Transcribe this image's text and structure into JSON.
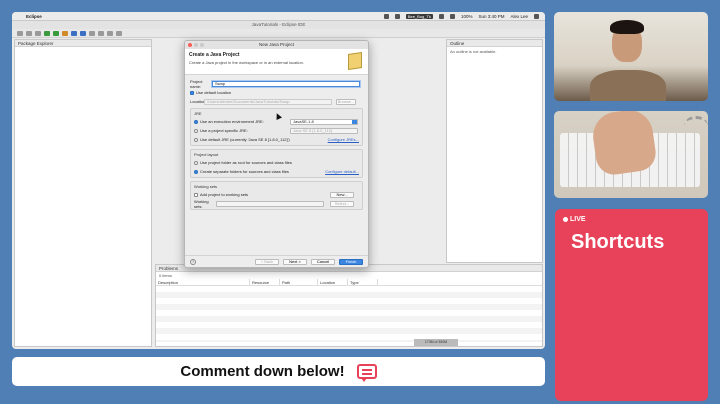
{
  "menubar": {
    "app_name": "Eclipse",
    "status_badge": "Bee_Bug_Tk",
    "battery": "100%",
    "clock": "Sun 3:40 PM",
    "user": "Alex Lee"
  },
  "window": {
    "title": "JavaTutorials - Eclipse IDE"
  },
  "package_explorer": {
    "tab_label": "Package Explorer"
  },
  "outline": {
    "tab_label": "Outline",
    "message": "An outline is not available."
  },
  "problems": {
    "tab_label": "Problems",
    "summary": "0 items",
    "columns": [
      "Description",
      "Resource",
      "Path",
      "Location",
      "Type"
    ]
  },
  "statusbar": {
    "text": "173M of 350M"
  },
  "dialog": {
    "title": "New Java Project",
    "heading": "Create a Java Project",
    "subheading": "Create a Java project in the workspace or in an external location.",
    "project_name_label": "Project name:",
    "project_name_value": "Swap",
    "use_default_location_label": "Use default location",
    "location_label": "Location:",
    "location_value": "/Users/alexlee/Documents/JavaTutorials/Swap",
    "browse_label": "Browse...",
    "jre_label": "JRE",
    "jre_opt1": "Use an execution environment JRE:",
    "jre_opt1_value": "JavaSE-1.8",
    "jre_opt2": "Use a project specific JRE:",
    "jre_opt2_value": "Java SE 8 [1.8.0_112]",
    "jre_opt3": "Use default JRE (currently 'Java SE 8 [1.8.0_112]')",
    "configure_jres": "Configure JREs...",
    "layout_label": "Project layout",
    "layout_opt1": "Use project folder as root for sources and class files",
    "layout_opt2": "Create separate folders for sources and class files",
    "configure_default": "Configure default...",
    "working_sets_label": "Working sets",
    "add_to_ws": "Add project to working sets",
    "new_button": "New...",
    "working_sets_field_label": "Working sets:",
    "select_button": "Select...",
    "help": "?",
    "back": "< Back",
    "next": "Next >",
    "cancel": "Cancel",
    "finish": "Finish"
  },
  "live_card": {
    "badge": "LIVE",
    "title": "Shortcuts"
  },
  "comment_bar": {
    "text": "Comment down below!"
  }
}
